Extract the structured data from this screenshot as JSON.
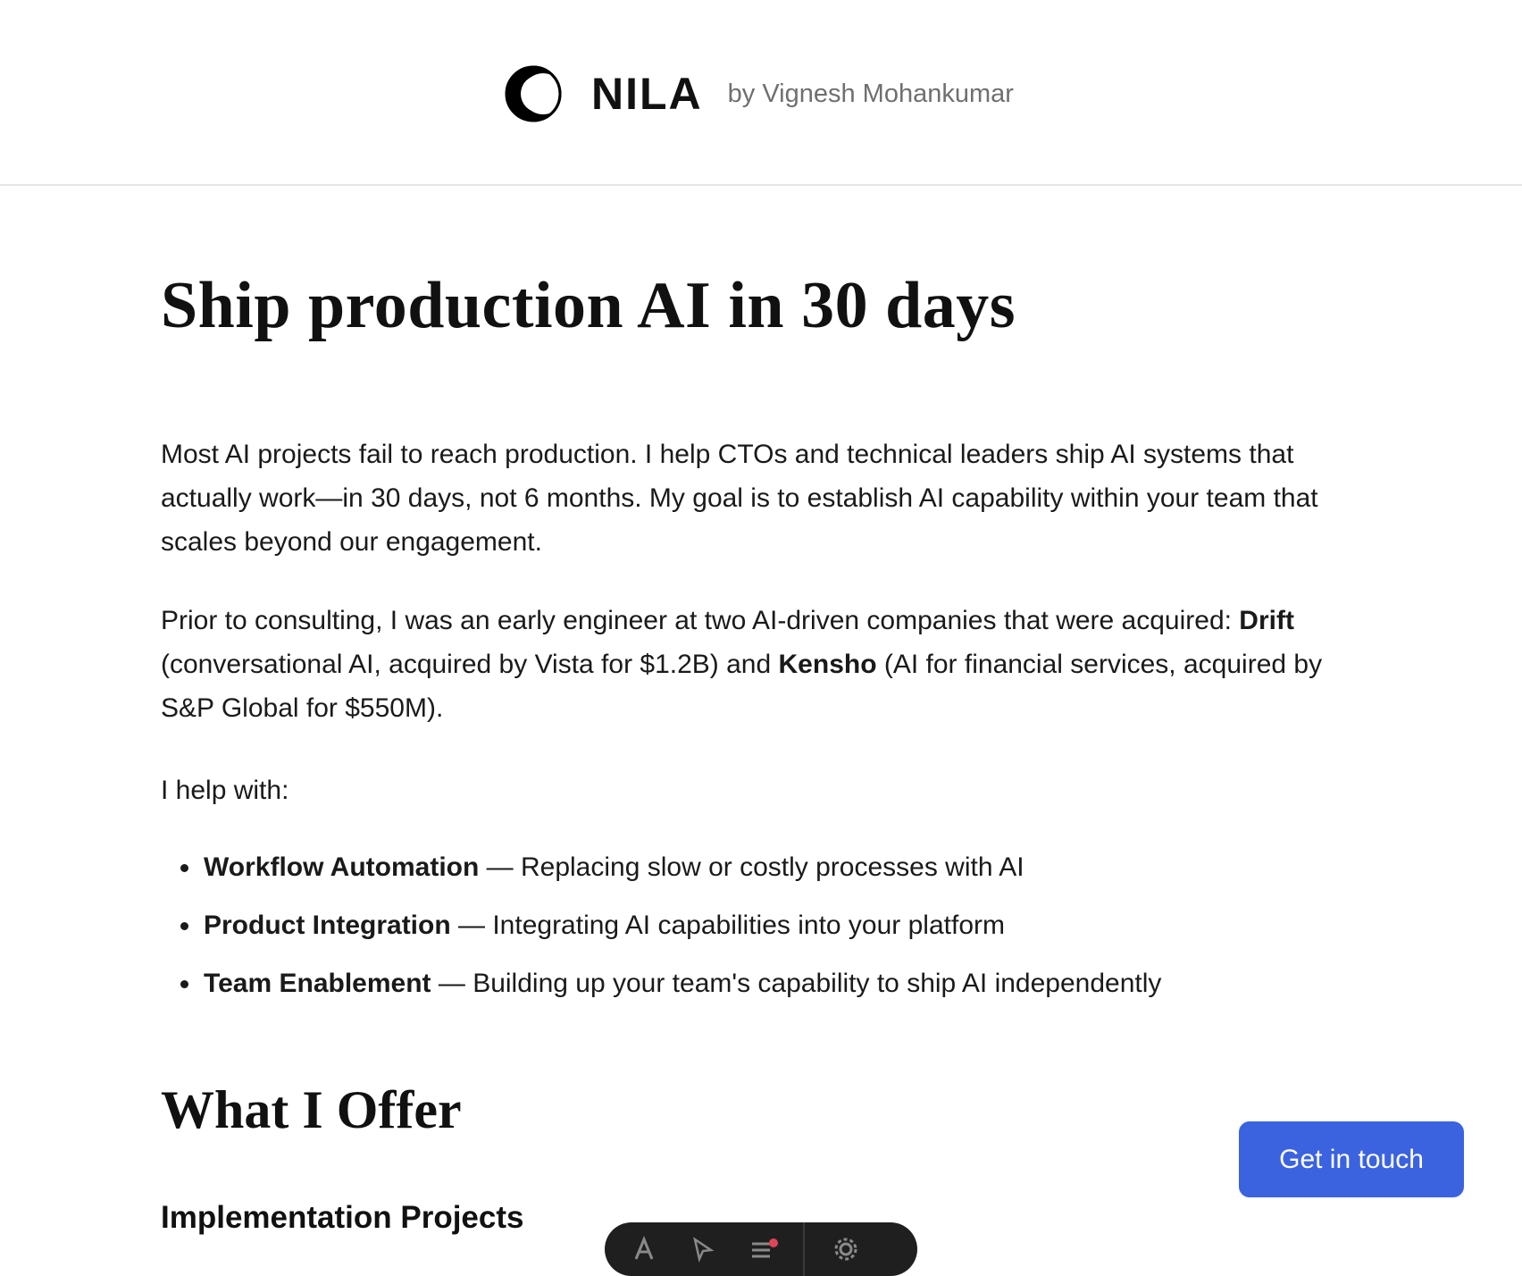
{
  "header": {
    "brand_name": "NILA",
    "byline": "by Vignesh Mohankumar"
  },
  "hero": {
    "title": "Ship production AI in 30 days"
  },
  "intro": {
    "p1": "Most AI projects fail to reach production. I help CTOs and technical leaders ship AI systems that actually work—in 30 days, not 6 months. My goal is to establish AI capability within your team that scales beyond our engagement.",
    "p2_lead": "Prior to consulting, I was an early engineer at two AI-driven companies that were acquired: ",
    "p2_drift": "Drift",
    "p2_mid": " (conversational AI, acquired by Vista for $1.2B) and ",
    "p2_kensho": "Kensho",
    "p2_tail": " (AI for financial services, acquired by S&P Global for $550M).",
    "p3": "I help with:"
  },
  "services": [
    {
      "name": "Workflow Automation",
      "desc": " — Replacing slow or costly processes with AI"
    },
    {
      "name": "Product Integration",
      "desc": " — Integrating AI capabilities into your platform"
    },
    {
      "name": "Team Enablement",
      "desc": " — Building up your team's capability to ship AI independently"
    }
  ],
  "offer": {
    "title": "What I Offer",
    "subtitle": "Implementation Projects"
  },
  "cta": {
    "label": "Get in touch",
    "color": "#3b63e0"
  },
  "toolbar": {
    "icons": [
      "text-icon",
      "pointer-icon",
      "menu-icon",
      "gear-icon"
    ]
  }
}
